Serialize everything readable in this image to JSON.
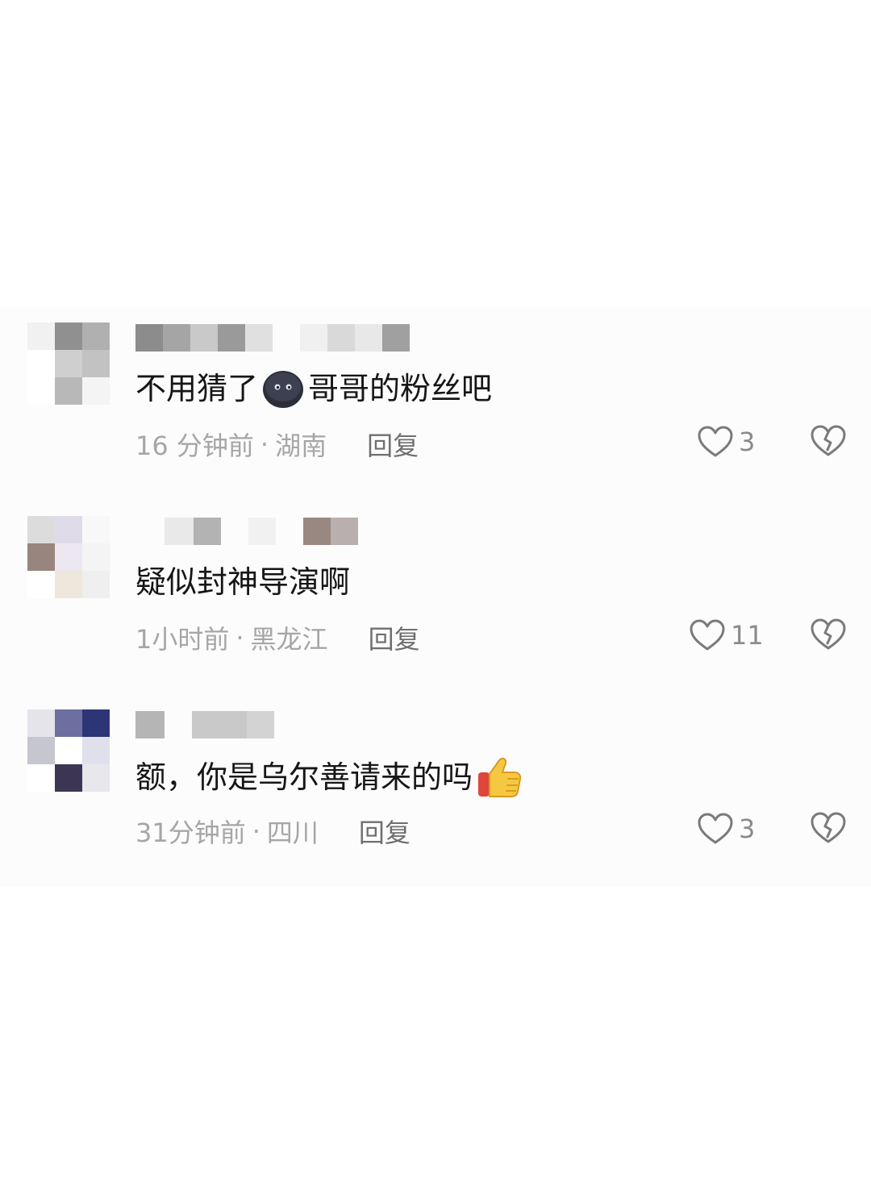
{
  "comments": [
    {
      "content": "不用猜了",
      "content_tail": "哥哥的粉丝吧",
      "emoji": "black-face-emoji",
      "time": "16 分钟前",
      "location": "湖南",
      "reply_label": "回复",
      "likes": "3",
      "avatar_colors": [
        "#f1f1f1",
        "#909090",
        "#b0b0b0",
        "#ffffff",
        "#cfcfcf",
        "#c2c2c2",
        "#ffffff",
        "#b8b8b8",
        "#f4f4f4"
      ],
      "name_colors": [
        "#8c8c8c",
        "#a5a5a5",
        "#c9c9c9",
        "#9a9a9a",
        "#e0e0e0",
        "#f0f0f0",
        "#d9d9d9",
        "#e8e8e8",
        "#a0a0a0"
      ]
    },
    {
      "content": "疑似封神导演啊",
      "time": "1小时前",
      "location": "黑龙江",
      "reply_label": "回复",
      "likes": "11",
      "avatar_colors": [
        "#dcdcdc",
        "#e0dbe8",
        "#f8f8f8",
        "#97857e",
        "#ece7f0",
        "#f4f4f4",
        "#ffffff",
        "#efe6dc",
        "#efefef"
      ],
      "name_colors": [
        "#e9e9e9",
        "#b3b3b3",
        "#f1f1f1",
        "#f0f0f0",
        "#998782",
        "#b8afae"
      ]
    },
    {
      "content": "额，你是乌尔善请来的吗",
      "emoji": "thumbs-up-emoji",
      "time": "31分钟前",
      "location": "四川",
      "reply_label": "回复",
      "likes": "3",
      "avatar_colors": [
        "#e4e4ea",
        "#6c6fa0",
        "#2e3576",
        "#c6c6ce",
        "#ffffff",
        "#e0e0ec",
        "#ffffff",
        "#3c3654",
        "#e7e7ec"
      ],
      "name_colors": [
        "#b5b5b5",
        "#c9c9c9",
        "#d3d3d3"
      ]
    }
  ],
  "meta_separator": "·"
}
